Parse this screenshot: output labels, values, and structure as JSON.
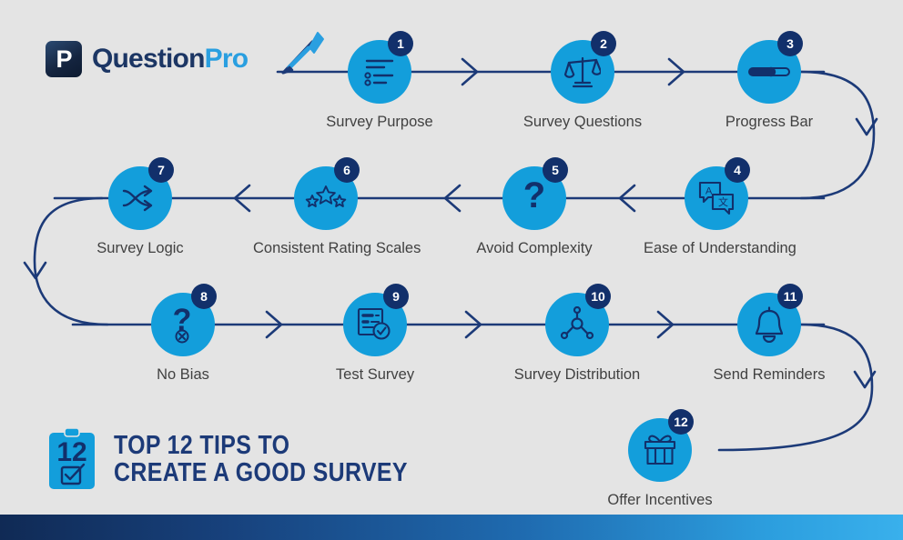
{
  "brand": {
    "logo_glyph": "P",
    "name_part_1": "Question",
    "name_part_2": "Pro",
    "dark_blue": "#12306b",
    "bright_blue": "#139edb",
    "accent_blue": "#2a9fe0",
    "background": "#e4e4e4"
  },
  "title": {
    "clipboard_number": "12",
    "line_1": "TOP 12 TIPS TO",
    "line_2": "CREATE A GOOD SURVEY"
  },
  "steps": [
    {
      "number": "1",
      "label": "Survey Purpose",
      "icon": "list-lines-icon"
    },
    {
      "number": "2",
      "label": "Survey Questions",
      "icon": "balance-scale-icon"
    },
    {
      "number": "3",
      "label": "Progress Bar",
      "icon": "progress-slider-icon"
    },
    {
      "number": "4",
      "label": "Ease of Understanding",
      "icon": "translate-chat-bubbles-icon"
    },
    {
      "number": "5",
      "label": "Avoid Complexity",
      "icon": "question-mark-icon"
    },
    {
      "number": "6",
      "label": "Consistent Rating Scales",
      "icon": "three-stars-icon"
    },
    {
      "number": "7",
      "label": "Survey Logic",
      "icon": "shuffle-arrows-icon"
    },
    {
      "number": "8",
      "label": "No Bias",
      "icon": "question-mark-x-icon"
    },
    {
      "number": "9",
      "label": "Test Survey",
      "icon": "document-check-icon"
    },
    {
      "number": "10",
      "label": "Survey Distribution",
      "icon": "share-nodes-icon"
    },
    {
      "number": "11",
      "label": "Send Reminders",
      "icon": "bell-icon"
    },
    {
      "number": "12",
      "label": "Offer Incentives",
      "icon": "gift-box-icon"
    }
  ]
}
